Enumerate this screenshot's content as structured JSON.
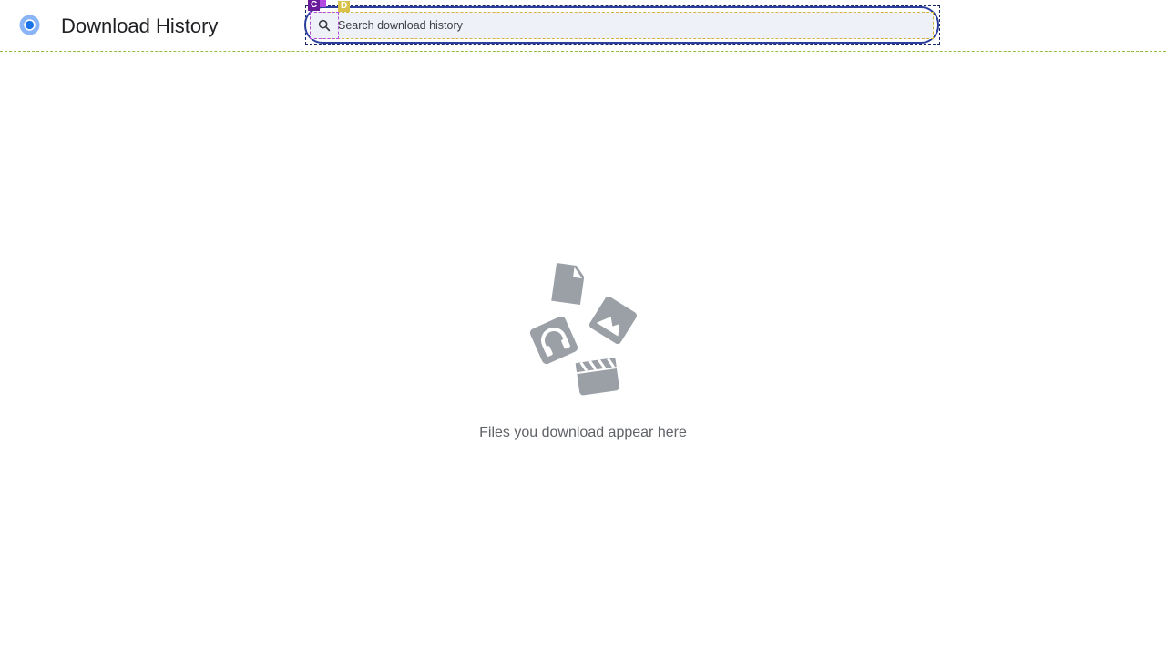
{
  "header": {
    "title": "Download History",
    "logo_icon": "chrome-logo-icon"
  },
  "search": {
    "placeholder": "Search download history",
    "icon": "search-icon",
    "value": ""
  },
  "overlay_markers": {
    "search_box_marker": "C",
    "search_input_marker": "D"
  },
  "empty_state": {
    "message": "Files you download appear here",
    "illustration_icons": [
      "document-icon",
      "image-icon",
      "audio-icon",
      "video-icon"
    ]
  },
  "colors": {
    "accent": "#2c3e9c",
    "icon_gray": "#9aa0a6",
    "logo_blue": "#1a73e8"
  }
}
